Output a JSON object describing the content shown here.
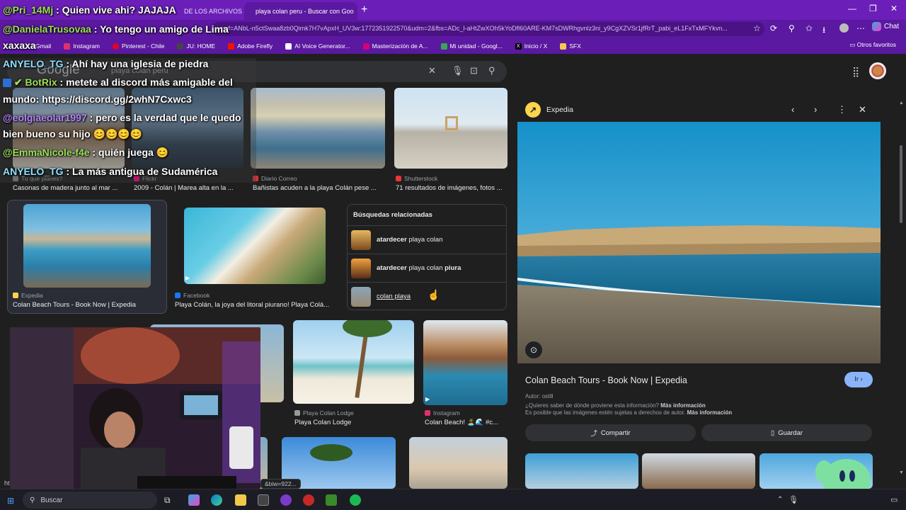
{
  "browser": {
    "tabs": [
      {
        "label": "DE LOS ARCHIVOS E"
      },
      {
        "label": "playa colan peru - Buscar con Goo"
      }
    ],
    "new_tab": "+",
    "url": "rsrf=ANbL-n5ctSwaa8zb0Qimk7H7vApxH_UV3w:1772351922570&udm=2&fbs=ADc_l-aHtZwXOh5kYoDfl60ARE-KM7sDWRhgvnlz3ni_y9CgXZVSr1jfRrT_pabi_eL1FxTxMFYkvn...",
    "chat_button": "Chat",
    "bookmarks": [
      {
        "label": "Gmail",
        "color": "#ea4335"
      },
      {
        "label": "Instagram",
        "color": "#e1306c"
      },
      {
        "label": "Pinterest - Chile",
        "color": "#e60023"
      },
      {
        "label": "JU: HOME",
        "color": "#444444"
      },
      {
        "label": "Adobe Firefly",
        "color": "#fa0f00"
      },
      {
        "label": "AI Voice Generator...",
        "color": "#ffffff"
      },
      {
        "label": "Masterización de A...",
        "color": "#d6007a"
      },
      {
        "label": "Mi unidad - Googl...",
        "color": "#34a853"
      },
      {
        "label": "Inicio / X",
        "color": "#000000"
      },
      {
        "label": "SFX",
        "color": "#f2c94c"
      }
    ],
    "other_favorites": "Otros favoritos"
  },
  "search": {
    "logo": "Google",
    "query": "playa colan peru"
  },
  "results": {
    "row1": [
      {
        "source": "Tu que planes?",
        "caption": "Casonas de madera junto al mar ..."
      },
      {
        "source": "Flickr",
        "caption": "2009 - Colán | Marea alta en la ..."
      },
      {
        "source": "Diario Correo",
        "caption": "Bañistas acuden a la playa Colán pese ..."
      },
      {
        "source": "Shutterstock",
        "caption": "71 resultados de imágenes, fotos ..."
      }
    ],
    "row2": [
      {
        "source": "Expedia",
        "caption": "Colan Beach Tours - Book Now | Expedia"
      },
      {
        "source": "Facebook",
        "caption": "Playa Colán, la joya del litoral piurano! Playa Colá..."
      }
    ],
    "row3": [
      {
        "source": "Playa Colan Lodge",
        "caption": "Playa Colan Lodge"
      },
      {
        "source": "Instagram",
        "caption": "Colan Beach! 🏝️🌊 #c..."
      }
    ]
  },
  "related": {
    "title": "Búsquedas relacionadas",
    "items": [
      {
        "bold": "atardecer",
        "rest": " playa colan",
        "bold2": ""
      },
      {
        "bold": "atardecer",
        "rest": " playa colan ",
        "bold2": "piura"
      },
      {
        "bold": "",
        "rest": "colan playa",
        "bold2": ""
      }
    ]
  },
  "panel": {
    "source": "Expedia",
    "title": "Colan Beach Tours - Book Now | Expedia",
    "visit": "Ir",
    "author": "Autor: ostill",
    "info1": "¿Quieres saber de dónde proviene esta información?",
    "info1_link": "Más información",
    "info2": "Es posible que las imágenes estén sujetas a derechos de autor.",
    "info2_link": "Más información",
    "share": "Compartir",
    "save": "Guardar"
  },
  "hover_url": "&biw=922...",
  "status_left": "ht",
  "chat_overlay": [
    {
      "user": "@Pri_14Mj",
      "msg": " : Quien vive ahi? JAJAJA",
      "color": "#9be05a"
    },
    {
      "user": "@DanielaTrusovaa",
      "msg": " : Yo tengo un amigo de Lima",
      "color": "#9be05a"
    },
    {
      "user": "xaxaxa",
      "msg": "",
      "color": "#ffffff"
    },
    {
      "user": "ANYELO_TG",
      "msg": " : Ahí hay una iglesia de piedra",
      "color": "#8ee0ff"
    },
    {
      "user": "BotRix",
      "msg": " : metete al discord más amigable del",
      "color": "#9be05a"
    },
    {
      "user": "",
      "msg": "mundo: https://discord.gg/2whN7Cxwc3",
      "color": "#ffffff"
    },
    {
      "user": "@eolgiaeolar1997",
      "msg": " : pero es la verdad que le quedo",
      "color": "#b784ff"
    },
    {
      "user": "",
      "msg": "bien bueno su hijo 😊😊😊😊",
      "color": "#ffffff"
    },
    {
      "user": "@EmmaNicole-f4e",
      "msg": " : quién juega 😊",
      "color": "#9be05a"
    },
    {
      "user": "ANYELO_TG",
      "msg": " : La más antigua de Sudamérica",
      "color": "#8ee0ff"
    }
  ],
  "taskbar": {
    "search_label": "Buscar"
  }
}
